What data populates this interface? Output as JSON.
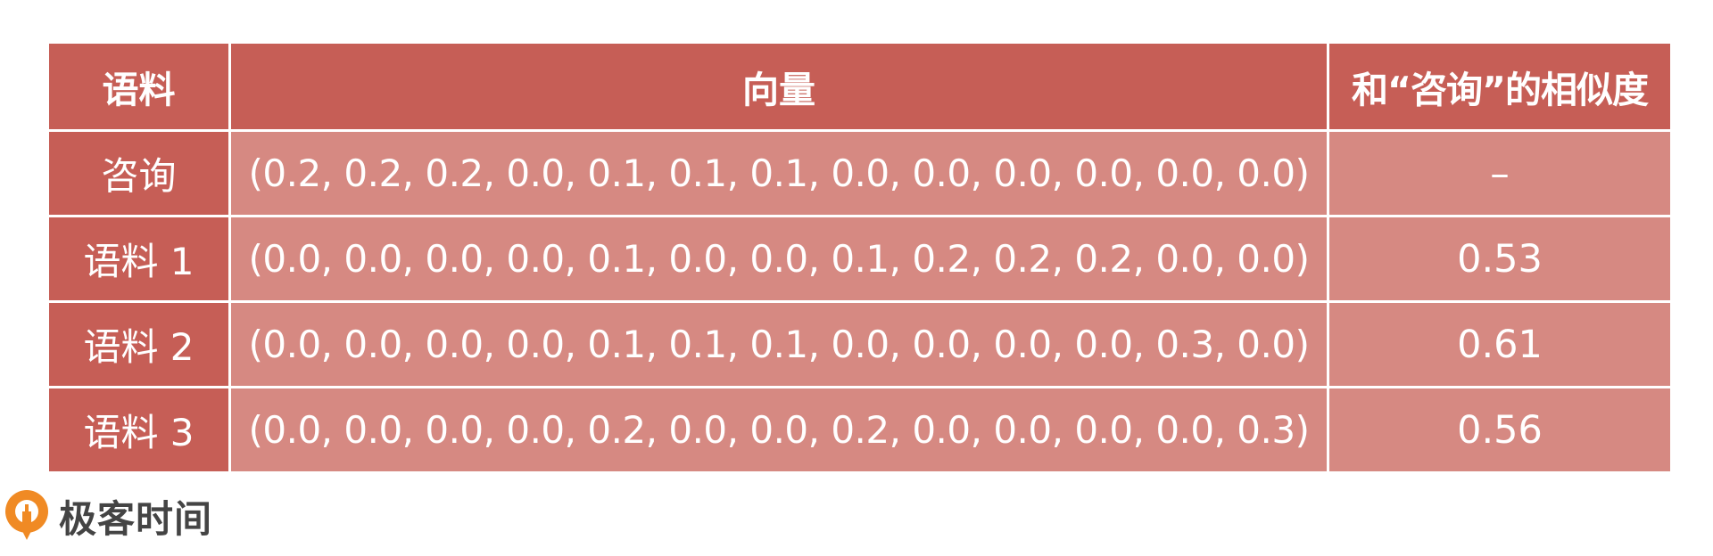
{
  "table": {
    "headers": [
      "语料",
      "向量",
      "和“咨询”的相似度"
    ],
    "rows": [
      {
        "name": "咨询",
        "vector": "(0.2, 0.2, 0.2, 0.0, 0.1, 0.1, 0.1, 0.0, 0.0, 0.0, 0.0, 0.0, 0.0)",
        "similarity": "–"
      },
      {
        "name": "语料 1",
        "vector": "(0.0, 0.0, 0.0, 0.0, 0.1, 0.0, 0.0, 0.1, 0.2, 0.2, 0.2, 0.0, 0.0)",
        "similarity": "0.53"
      },
      {
        "name": "语料 2",
        "vector": "(0.0, 0.0, 0.0, 0.0, 0.1, 0.1, 0.1, 0.0, 0.0, 0.0, 0.0, 0.3, 0.0)",
        "similarity": "0.61"
      },
      {
        "name": "语料 3",
        "vector": "(0.0, 0.0, 0.0, 0.0, 0.2, 0.0, 0.0, 0.2, 0.0, 0.0, 0.0, 0.0, 0.3)",
        "similarity": "0.56"
      }
    ]
  },
  "brand": {
    "name": "极客时间",
    "icon": "geektime-logo-icon"
  },
  "colors": {
    "header_bg": "#c65e56",
    "cell_bg": "#d68982",
    "logo_orange": "#f08a24",
    "brand_text": "#444444"
  }
}
